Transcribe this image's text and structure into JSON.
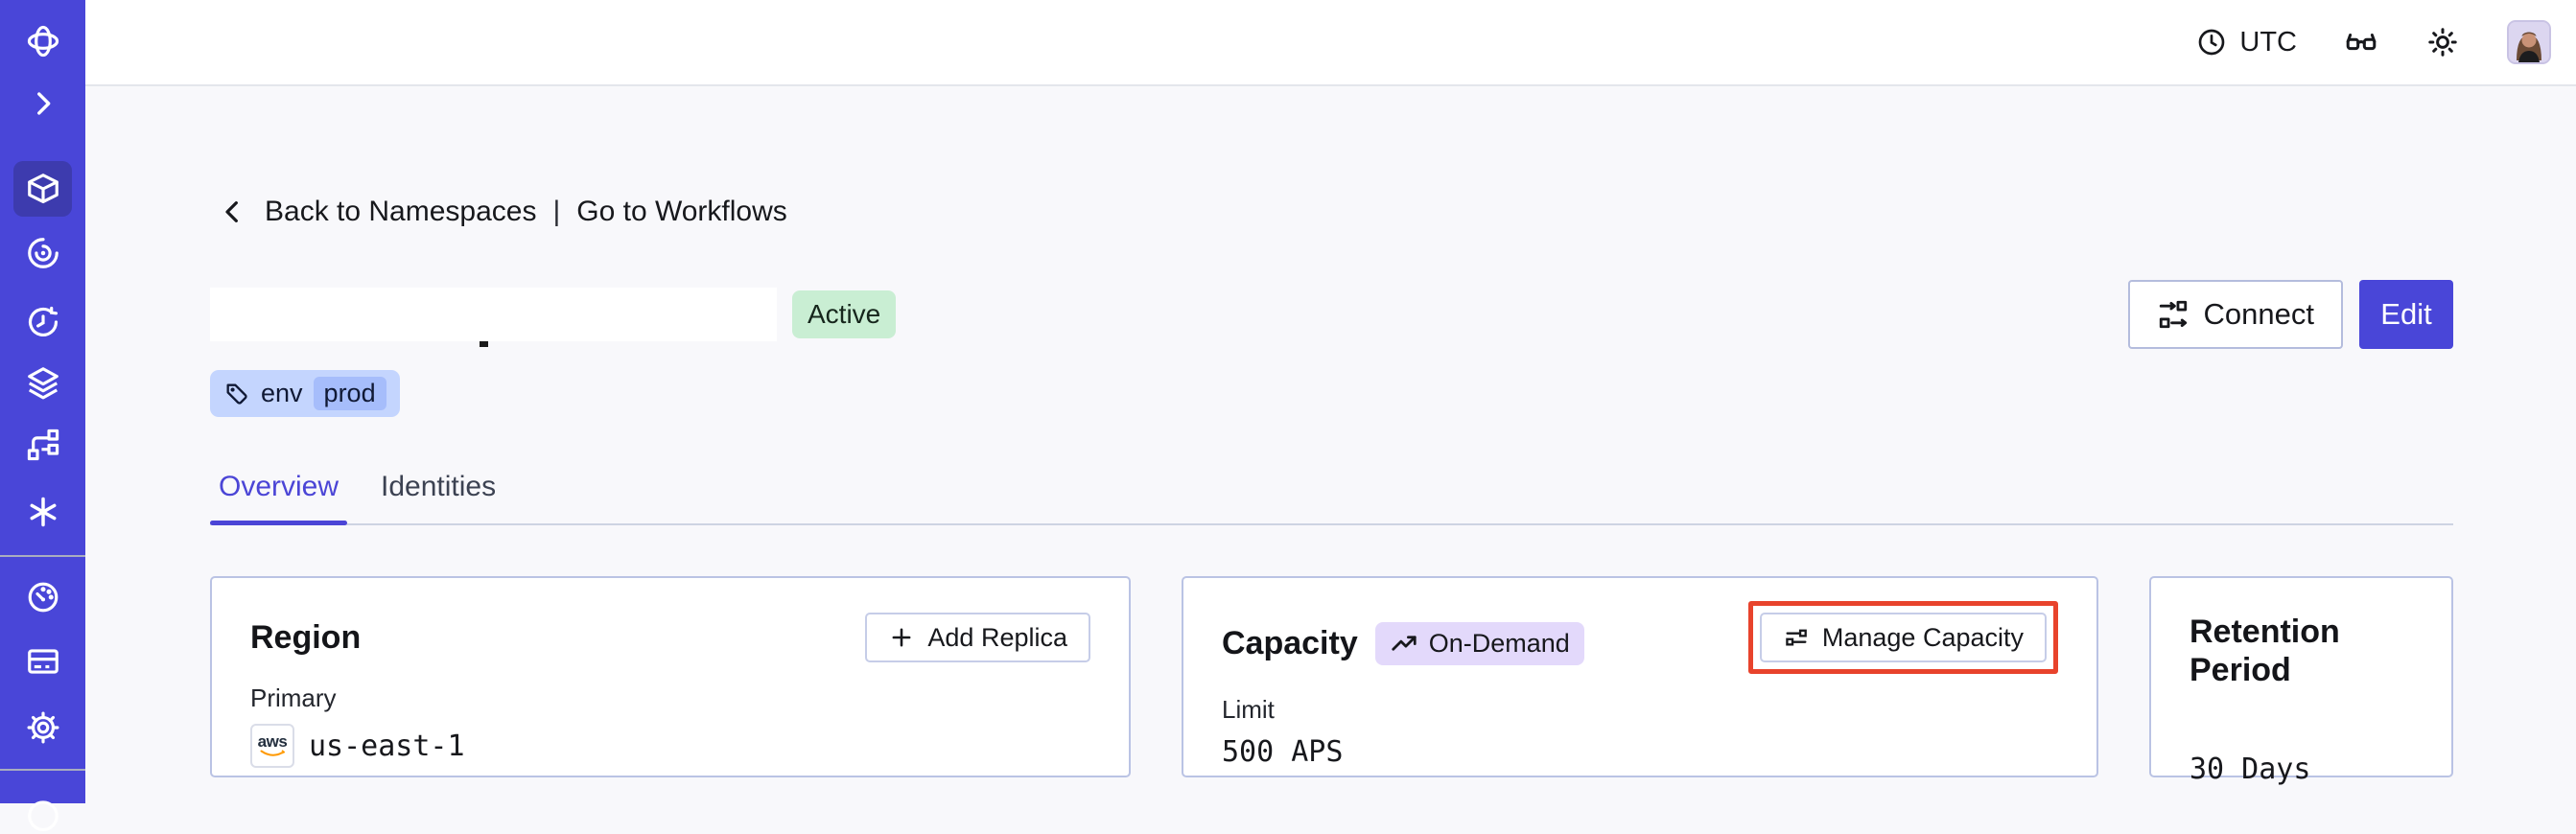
{
  "header": {
    "timezone": "UTC",
    "icons": [
      "clock-icon",
      "glasses-icon",
      "sun-icon",
      "avatar"
    ]
  },
  "sidebar": {
    "icons": [
      "temporal-logo",
      "expand-chevron",
      "namespaces-cube",
      "nexus-spiral",
      "schedules-clock",
      "layers-stack",
      "branch-graph",
      "asterisk",
      "usage-gauge",
      "billing-card",
      "settings-gear",
      "support-circle"
    ],
    "active_item": "namespaces-cube"
  },
  "breadcrumb": {
    "back_label": "Back to Namespaces",
    "separator": "|",
    "forward_label": "Go to Workflows"
  },
  "namespace": {
    "name_redacted": true,
    "status_label": "Active",
    "tag": {
      "key": "env",
      "value": "prod"
    }
  },
  "actions": {
    "connect_label": "Connect",
    "edit_label": "Edit"
  },
  "tabs": [
    {
      "label": "Overview",
      "active": true
    },
    {
      "label": "Identities",
      "active": false
    }
  ],
  "cards": {
    "region": {
      "title": "Region",
      "add_replica_label": "Add Replica",
      "primary_label": "Primary",
      "provider": "aws",
      "region_value": "us-east-1"
    },
    "capacity": {
      "title": "Capacity",
      "badge_label": "On-Demand",
      "limit_label": "Limit",
      "limit_value": "500 APS",
      "manage_label": "Manage Capacity",
      "annotated": true
    },
    "retention": {
      "title": "Retention Period",
      "value": "30 Days"
    }
  },
  "colors": {
    "sidebar": "#4946D8",
    "sidebar_active": "#3D3BAE",
    "accent": "#4B45D6",
    "primary_button": "#4946D8",
    "status_active_bg": "#C9EED3",
    "tag_bg": "#C4D5FE",
    "tag_chip_bg": "#A6BDFB",
    "ondemand_bg": "#E3D9FB",
    "annotation_red": "#E8432C",
    "card_border": "#BAC3E4",
    "aws_orange": "#FF9900",
    "page_bg": "#F8F8FB"
  }
}
